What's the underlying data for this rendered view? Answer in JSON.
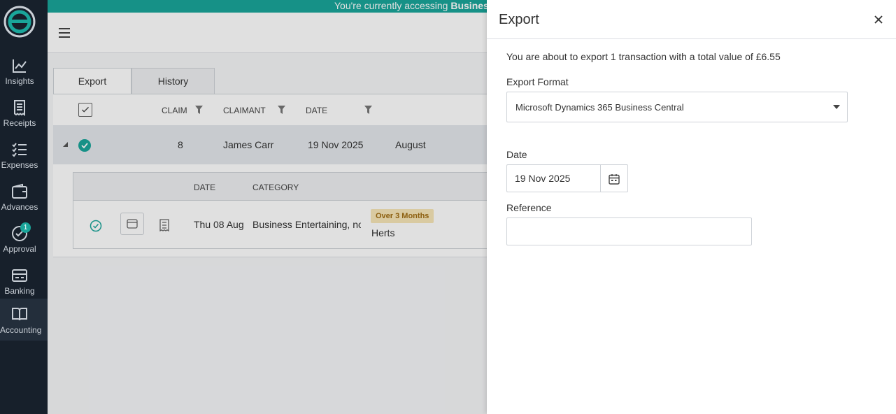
{
  "banner": {
    "text": "You're currently accessing ",
    "bold": "BusinessCe"
  },
  "nav": [
    {
      "label": "Insights",
      "icon": "chart-line-icon"
    },
    {
      "label": "Receipts",
      "icon": "receipt-icon"
    },
    {
      "label": "Expenses",
      "icon": "list-check-icon"
    },
    {
      "label": "Advances",
      "icon": "wallet-icon"
    },
    {
      "label": "Approval",
      "icon": "check-circle-icon",
      "badge": "1"
    },
    {
      "label": "Banking",
      "icon": "card-icon"
    },
    {
      "label": "Accounting",
      "icon": "book-open-icon",
      "active": true
    }
  ],
  "tabs": {
    "export": "Export",
    "history": "History"
  },
  "table": {
    "headers": {
      "claim": "CLAIM",
      "claimant": "CLAIMANT",
      "date": "DATE"
    },
    "row": {
      "claim": "8",
      "claimant": "James Carr",
      "date": "19 Nov 2025",
      "period": "August"
    },
    "sub_headers": {
      "date": "DATE",
      "category": "CATEGORY"
    },
    "sub_row": {
      "date": "Thu 08 Aug",
      "category": "Business Entertaining, non",
      "tag": "Over 3 Months",
      "location": "Herts"
    }
  },
  "panel": {
    "title": "Export",
    "message": "You are about to export 1 transaction with a total value of £6.55",
    "format_label": "Export Format",
    "format_value": "Microsoft Dynamics 365 Business Central",
    "date_label": "Date",
    "date_value": "19 Nov 2025",
    "reference_label": "Reference",
    "reference_value": ""
  },
  "colors": {
    "accent": "#1aa59a",
    "sidebar": "#17202b"
  }
}
